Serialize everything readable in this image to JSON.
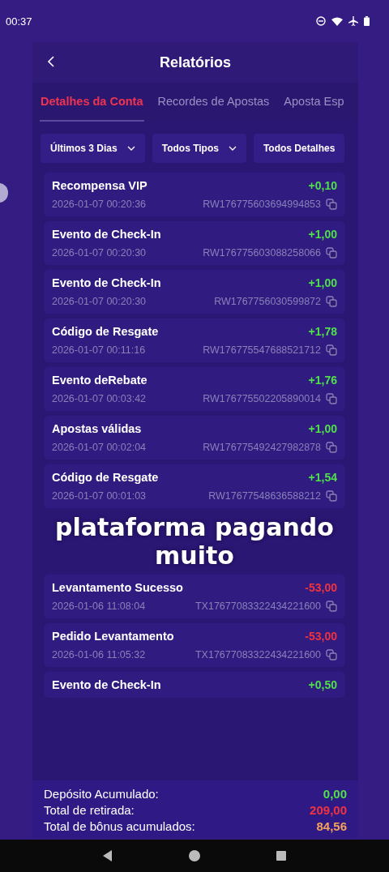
{
  "status_bar": {
    "time": "00:37"
  },
  "header": {
    "title": "Relatórios"
  },
  "tabs": [
    {
      "label": "Detalhes da Conta",
      "selected": true
    },
    {
      "label": "Recordes de Apostas",
      "selected": false
    },
    {
      "label": "Aposta Esp",
      "selected": false
    }
  ],
  "filters": [
    {
      "label": "Últimos 3 Dias",
      "caret": true
    },
    {
      "label": "Todos Tipos",
      "caret": true
    },
    {
      "label": "Todos Detalhes",
      "caret": false
    }
  ],
  "transactions": [
    {
      "title": "Recompensa VIP",
      "amount": "+0,10",
      "kind": "credit",
      "date": "2026-01-07 00:20:36",
      "id": "RW176775603694994853"
    },
    {
      "title": "Evento de Check-In",
      "amount": "+1,00",
      "kind": "credit",
      "date": "2026-01-07 00:20:30",
      "id": "RW176775603088258066"
    },
    {
      "title": "Evento de Check-In",
      "amount": "+1,00",
      "kind": "credit",
      "date": "2026-01-07 00:20:30",
      "id": "RW1767756030599872"
    },
    {
      "title": "Código de Resgate",
      "amount": "+1,78",
      "kind": "credit",
      "date": "2026-01-07 00:11:16",
      "id": "RW176775547688521712"
    },
    {
      "title": "Evento deRebate",
      "amount": "+1,76",
      "kind": "credit",
      "date": "2026-01-07 00:03:42",
      "id": "RW176775502205890014"
    },
    {
      "title": "Apostas válidas",
      "amount": "+1,00",
      "kind": "credit",
      "date": "2026-01-07 00:02:04",
      "id": "RW176775492427982878"
    },
    {
      "title": "Código de Resgate",
      "amount": "+1,54",
      "kind": "credit",
      "date": "2026-01-07 00:01:03",
      "id": "RW17677548636588212"
    },
    {
      "title": "Levantamento Sucesso",
      "amount": "-53,00",
      "kind": "debit",
      "date": "2026-01-06 11:08:04",
      "id": "TX17677083322434221600"
    },
    {
      "title": "Pedido Levantamento",
      "amount": "-53,00",
      "kind": "debit",
      "date": "2026-01-06 11:05:32",
      "id": "TX17677083322434221600"
    },
    {
      "title": "Evento de Check-In",
      "amount": "+0,50",
      "kind": "credit"
    }
  ],
  "totals": [
    {
      "label": "Depósito Acumulado:",
      "value": "0,00",
      "kind": "credit"
    },
    {
      "label": "Total de retirada:",
      "value": "209,00",
      "kind": "debit"
    },
    {
      "label": "Total de bônus acumulados:",
      "value": "84,56",
      "kind": "bonus"
    }
  ],
  "caption": {
    "lines": [
      "plataforma pagando",
      "muito"
    ]
  }
}
